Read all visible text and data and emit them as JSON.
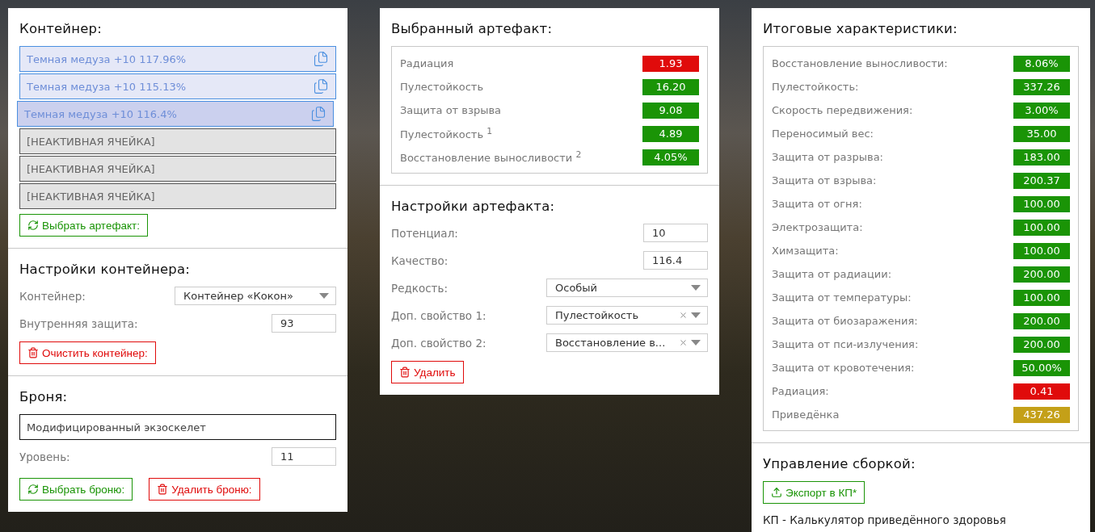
{
  "container": {
    "title": "Контейнер:",
    "slots": [
      {
        "kind": "artifact",
        "label": "Темная медуза +10 117.96%",
        "selected": false
      },
      {
        "kind": "artifact",
        "label": "Темная медуза +10 115.13%",
        "selected": false
      },
      {
        "kind": "artifact",
        "label": "Темная медуза +10 116.4%",
        "selected": true
      },
      {
        "kind": "inactive",
        "label": "[НЕАКТИВНАЯ ЯЧЕЙКА]",
        "selected": false
      },
      {
        "kind": "inactive",
        "label": "[НЕАКТИВНАЯ ЯЧЕЙКА]",
        "selected": false
      },
      {
        "kind": "inactive",
        "label": "[НЕАКТИВНАЯ ЯЧЕЙКА]",
        "selected": false
      }
    ],
    "button": "Выбрать артефакт:"
  },
  "container_settings": {
    "title": "Настройки контейнера:",
    "fields": [
      {
        "kind": "select",
        "label": "Контейнер:",
        "value": "Контейнер «Кокон»",
        "clearable": false
      },
      {
        "kind": "input",
        "label": "Внутренняя защита:",
        "value": "93"
      }
    ],
    "button": "Очистить контейнер:"
  },
  "armor": {
    "title": "Броня:",
    "name": "Модифицированный экзоскелет",
    "fields": [
      {
        "kind": "input",
        "label": "Уровень:",
        "value": "11"
      }
    ],
    "buttons": [
      {
        "kind": "select",
        "label": "Выбрать броню:"
      },
      {
        "kind": "delete",
        "label": "Удалить броню:"
      }
    ]
  },
  "selected_artifact": {
    "title": "Выбранный артефакт:",
    "stats": [
      {
        "label": "Радиация",
        "value": "1.93",
        "color": "#e00b0b"
      },
      {
        "label": "Пулестойкость",
        "value": "16.20",
        "color": "#1a9406"
      },
      {
        "label": "Защита от взрыва",
        "value": "9.08",
        "color": "#1a9406"
      },
      {
        "label": "Пулестойкость $^{1}$",
        "value": "4.89",
        "color": "#1a9406"
      },
      {
        "label": "Восстановление выносливости $^{2}$",
        "value": "4.05%",
        "color": "#1a9406"
      }
    ]
  },
  "artifact_settings": {
    "title": "Настройки артефакта:",
    "fields": [
      {
        "kind": "input",
        "label": "Потенциал:",
        "value": "10"
      },
      {
        "kind": "input",
        "label": "Качество:",
        "value": "116.4"
      },
      {
        "kind": "select",
        "label": "Редкость:",
        "value": "Особый",
        "clearable": false
      },
      {
        "kind": "select",
        "label": "Доп. свойство 1:",
        "value": "Пулестойкость",
        "clearable": true
      },
      {
        "kind": "select",
        "label": "Доп. свойство 2:",
        "value": "Восстановление в...",
        "clearable": true
      }
    ],
    "button": "Удалить"
  },
  "totals": {
    "title": "Итоговые характеристики:",
    "stats": [
      {
        "label": "Восстановление выносливости:",
        "value": "8.06%",
        "color": "#1a9406"
      },
      {
        "label": "Пулестойкость:",
        "value": "337.26",
        "color": "#1a9406"
      },
      {
        "label": "Скорость передвижения:",
        "value": "3.00%",
        "color": "#1a9406"
      },
      {
        "label": "Переносимый вес:",
        "value": "35.00",
        "color": "#1a9406"
      },
      {
        "label": "Защита от разрыва:",
        "value": "183.00",
        "color": "#1a9406"
      },
      {
        "label": "Защита от взрыва:",
        "value": "200.37",
        "color": "#1a9406"
      },
      {
        "label": "Защита от огня:",
        "value": "100.00",
        "color": "#1a9406"
      },
      {
        "label": "Электрозащита:",
        "value": "100.00",
        "color": "#1a9406"
      },
      {
        "label": "Химзащита:",
        "value": "100.00",
        "color": "#1a9406"
      },
      {
        "label": "Защита от радиации:",
        "value": "200.00",
        "color": "#1a9406"
      },
      {
        "label": "Защита от температуры:",
        "value": "100.00",
        "color": "#1a9406"
      },
      {
        "label": "Защита от биозаражения:",
        "value": "200.00",
        "color": "#1a9406"
      },
      {
        "label": "Защита от пси-излучения:",
        "value": "200.00",
        "color": "#1a9406"
      },
      {
        "label": "Защита от кровотечения:",
        "value": "50.00%",
        "color": "#1a9406"
      },
      {
        "label": "Радиация:",
        "value": "0.41",
        "color": "#e00b0b"
      },
      {
        "label": "Приведёнка",
        "value": "437.26",
        "color": "#c4a018"
      }
    ]
  },
  "build": {
    "title": "Управление сборкой:",
    "button": "Экспорт в КП*",
    "note": "КП - Калькулятор приведённого здоровья"
  }
}
